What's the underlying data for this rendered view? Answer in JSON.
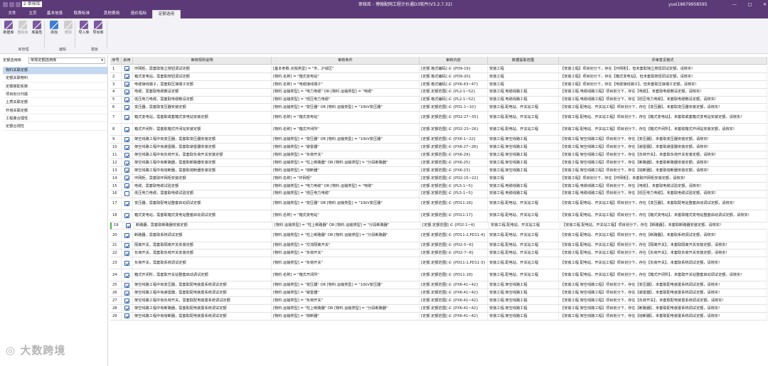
{
  "app": {
    "window_title": "审核库 - 博微配网工程计价通D3软件(V3.2.7.32)",
    "quick_access_value": "2 审核库",
    "user": "yuxi18679958595",
    "min_icon": "minimize-icon",
    "max_icon": "maximize-icon",
    "close_icon": "close-icon"
  },
  "menu": {
    "tabs": [
      "文件",
      "主页",
      "基本信息",
      "取费标准",
      "其他费用",
      "造价指标",
      "定额选用"
    ],
    "active": 6
  },
  "ribbon": {
    "buttons": [
      {
        "label": "新建库",
        "icon": "new-library-icon",
        "disabled": false
      },
      {
        "label": "删除库",
        "icon": "delete-library-icon",
        "disabled": true
      },
      {
        "label": "库属性",
        "icon": "library-properties-icon",
        "disabled": false
      },
      {
        "label": "添加",
        "icon": "add-chart-icon",
        "disabled": false
      },
      {
        "label": "删除",
        "icon": "trash-icon",
        "disabled": true
      },
      {
        "label": "导入库",
        "icon": "import-library-icon",
        "disabled": false
      },
      {
        "label": "导出库",
        "icon": "export-library-icon",
        "disabled": false
      }
    ],
    "groups": [
      "库管理",
      "编辑",
      "模板"
    ],
    "colors": {
      "accent": "#5c3a78",
      "icon_purple": "#7b5aa0",
      "icon_blue": "#3d7fd0",
      "disabled": "#b5b5b5"
    }
  },
  "sidebar": {
    "select_label": "定额选用库",
    "select_value": "常规定额选用库",
    "selected_index": 0,
    "items": [
      "物料关联定额",
      "定额关联物料",
      "定额搭配系数",
      "项目划分归属",
      "土质关联定额",
      "杆塔关联定额",
      "工程量合理性",
      "定额合规性"
    ]
  },
  "table": {
    "headers": [
      "序号",
      "启用",
      "审核规则说明",
      "审核条件",
      "审核内容",
      "数据提取范围",
      "评审意见格式"
    ],
    "rows": [
      {
        "seq": "1",
        "on": true,
        "desc": "环网柜，需套取独立按钮调试定额",
        "cond": "[基本参数.点独类型] = \"市、沪城区\"",
        "content": "[定额.格式编码] ∈ {PD9-19}",
        "range": "安装工程",
        "opinion": "【安装工程】项目划分下，存在【环网柜】，但未套取独立按钮调试定额，请核实!"
      },
      {
        "seq": "2",
        "on": true,
        "desc": "箱式变电站，需套取按钮调试定额",
        "cond": "[物料.名称] = \"箱式变电站\"",
        "content": "[定额.格式编码] ∈ {PD9-20}",
        "range": "安装工程",
        "opinion": "【安装工程】项目划分下，存在【箱式变电站】，但未套取按钮调试定额，请核实!"
      },
      {
        "seq": "3",
        "on": true,
        "desc": "电缆接线端子，需套取压接端子定额",
        "cond": "[物料.名称] = \"电缆接线端子\"",
        "content": "[定额.格式编码] ∈ {PX6-43~47}",
        "range": "安装工程",
        "opinion": "【安装工程】项目划分下，存在【电缆接线端子】，但未套取压接端子定额，请核实!"
      },
      {
        "seq": "4",
        "on": true,
        "desc": "电缆，需套取电缆敷设定额",
        "cond": "[物料.运输类型] = \"电力电缆\" OR [物料.运输类型] = \"电缆\"",
        "content": "[定额.定额范围] ∈ {PL2-1~52}",
        "range": "安装工程.电缆线路工程",
        "opinion": "【安装工程.电缆线路工程】项目划分下，存在【电缆】，未套取电缆敷设定额，请核实!"
      },
      {
        "seq": "5",
        "on": true,
        "desc": "低压电力电缆，需套取电缆敷设定额",
        "cond": "[物料.运输类型] = \"低压电力电缆\"",
        "content": "[定额.格式编码] ∈ {PL2-1~52}",
        "range": "安装工程.电缆线路工程",
        "opinion": "【安装工程.电缆线路工程】项目划分下，存在【低压电力电缆】，未套取电缆敷设定额，请核实!"
      },
      {
        "seq": "6",
        "on": true,
        "desc": "变压器，需套取变压器安装定额",
        "cond": "[物料.运输类型] = \"变压器\" OR [物料.运输类型] = \"10kV变压器\"",
        "content": "[定额.定额范围] ∈ {PD1-1~10}",
        "range": "安装工程.配电站、开关站工程",
        "opinion": "【安装工程.配电站、开关站工程】项目划分下，存在【变压器】，未套取变压器安装定额，请核实!"
      },
      {
        "seq": "7",
        "on": true,
        "desc": "箱式变电站，需套取或套箱式变电站安装定额",
        "cond": "[物料.名称] = \"箱式变电站\"",
        "content": "[定额.定额范围] ∈ {PD2-27~35}",
        "range": "安装工程.配电站、开关站工程",
        "opinion": "【安装工程.配电站、开关站工程】项目划分下，存在【箱式变电站】，未套取或套箱式变电站安装定额，请核实!"
      },
      {
        "seq": "8",
        "on": true,
        "desc": "箱式开闭所，需套取箱式开闭站安装定额",
        "cond": "[物料.名称] = \"箱式开闭所\"",
        "content": "[定额.定额范围] ∈ {PD2-23~26}",
        "range": "安装工程.配电站、开关站工程",
        "opinion": "【安装工程.配电站、开关站工程】项目划分下，存在【箱式开闭所】，未套取箱式开闭站安装定额，请核实!"
      },
      {
        "seq": "9",
        "on": true,
        "desc": "架空线路工程中有变压器，需套取变压器安装定额",
        "cond": "[物料.运输类型] = \"变压器\" OR [物料.运输类型] = \"10kV变压器\"",
        "content": "[定额.定额范围] ∈ {PX6-1~22}",
        "range": "安装工程.架空线路工程",
        "opinion": "【安装工程.架空线路工程】项目划分下，存在【变压器】，未套取变压器安装定额，请核实!"
      },
      {
        "seq": "10",
        "on": true,
        "desc": "架空线路工程中有避雷器，需套取避雷器安装定额",
        "cond": "[物料.运输类型] = \"避雷器\"",
        "content": "[定额.定额范围] ∈ {PX6-27~28}",
        "range": "安装工程.架空线路工程",
        "opinion": "【安装工程.架空线路工程】项目划分下，存在【避雷器】，未套取避雷器安装定额，请核实!"
      },
      {
        "seq": "11",
        "on": true,
        "desc": "架空线路工程中有负荷开关，需套取负荷开关安装定额",
        "cond": "[物料.运输类型] = \"负荷开关\"",
        "content": "[定额.定额范围] ∈ {PX6-29}",
        "range": "安装工程.架空线路工程",
        "opinion": "【安装工程.架空线路工程】项目划分下，存在【负荷开关】，未套取负荷开关安装定额，请核实!"
      },
      {
        "seq": "12",
        "on": true,
        "desc": "架空线路工程中有断路器，需套取断路器安装定额",
        "cond": "[物料.运输类型] = \"柱上断路器\" OR [物料.运输类型] = \"分段断路器\"",
        "content": "[定额.定额范围] ∈ {PX6-25}",
        "range": "安装工程.架空线路工程",
        "opinion": "【安装工程.架空线路工程】项目划分下，存在【断路器】，未套取断路器安装定额，请核实!"
      },
      {
        "seq": "13",
        "on": true,
        "desc": "架空线路工程中有熔断器，需套取熔断器安装定额",
        "cond": "[物料.运输类型] = \"熔断器\"",
        "content": "[定额.定额范围] ∈ {PX6-23}",
        "range": "安装工程.架空线路工程",
        "opinion": "【安装工程.架空线路工程】项目划分下，存在【熔断器】，未套取熔断器安装定额，请核实!"
      },
      {
        "seq": "14",
        "on": true,
        "desc": "环网柜，需套取环网柜安装定额",
        "cond": "[物料.名称] = \"环网柜\"",
        "content": "[定额.定额范围] ∈ {PD2-15~22}",
        "range": "安装工程",
        "opinion": "【安装工程】项目划分下，存在【环网柜】，未套取环网柜安装定额，请核实!"
      },
      {
        "seq": "15",
        "on": true,
        "desc": "电缆，需套取电缆试验定额",
        "cond": "[物料.运输类型] = \"电力电缆\" OR [物料.运输类型] = \"电缆\"",
        "content": "[定额.定额范围] ∈ {PL5-1~5}",
        "range": "安装工程.电缆线路工程",
        "opinion": "【安装工程.电缆线路工程】项目划分下，存在【电缆】，未套取电缆试验定额，请核实!"
      },
      {
        "seq": "16",
        "on": false,
        "desc": "低压电力电缆，需套取电缆试验定额",
        "cond": "[物料.运输类型] = \"低压电力电缆\"",
        "content": "[定额.定额范围] ∈ {PL5-1~5}",
        "range": "安装工程.电缆线路工程",
        "opinion": "【安装工程.电缆线路工程】项目划分下，存在【低压电力电缆】，未套取电缆试验定额，请核实!"
      },
      {
        "seq": "17",
        "on": true,
        "desc": "变压器，需套取配电站整套启动调试定额",
        "cond": "[物料.运输类型] = \"变压器\" OR [物料.运输类型] = \"10kV变压器\"",
        "content": "[定额.定额范围] ∈ {PD11-16}",
        "range": "安装工程.配电站、开关站工程",
        "opinion": "【安装工程.配电站、开关站工程】项目划分下，存在【变压器】，未套取配电站整套启动调试定额，请核实!"
      },
      {
        "seq": "18",
        "on": true,
        "desc": "箱式变电站，需套取箱式变电站整套启动调试定额",
        "cond": "[物料.名称] = \"箱式变电站\"",
        "content": "[定额.定额范围] ∈ {PD11-17}",
        "range": "安装工程.配电站、开关站工程",
        "opinion": "【安装工程.配电站、开关站工程】项目划分下，存在【箱式变电站】，未套取箱式变电站整套启动调试定额，请核实!"
      },
      {
        "seq": "19",
        "on": true,
        "desc": "断路器，需套取断路器安装定额",
        "cond": "[物料.运输类型] = \"柱上断路器\" OR [物料.运输类型] = \"分段断路器\"",
        "content": "[定额.定额范围] ∈ {PD2-1~4}",
        "range": "安装工程.配电站、开关站工程",
        "opinion": "【安装工程.配电站、开关站工程】项目划分下，存在【断路器】，未套取断路器安装定额，请核实!"
      },
      {
        "seq": "20",
        "on": true,
        "desc": "断路器，需套取系统调试定额",
        "cond": "[物料.运输类型] = \"柱上断路器\" OR [物料.运输类型] = \"分段断路器\"",
        "content": "[定额.定额范围] ∈ {PD11-2,PD11-4}",
        "range": "安装工程.配电站、开关站工程",
        "opinion": "【安装工程.配电站、开关站工程】项目划分下，存在【断路器】，未套取系统调试定额，请核实!"
      },
      {
        "seq": "21",
        "on": true,
        "desc": "隔离开关，需套取隔离开关安装定额",
        "cond": "[物料.运输类型] = \"交流隔离开关\"",
        "content": "[定额.定额范围] ∈ {PD2-5~6}",
        "range": "安装工程.配电站、开关站工程",
        "opinion": "【安装工程.配电站、开关站工程】项目划分下，存在【隔离开关】，未套取隔离开关安装定额，请核实!"
      },
      {
        "seq": "22",
        "on": true,
        "desc": "负荷开关，需套取负荷开关安装定额",
        "cond": "[物料.运输类型] = \"负荷开关\"",
        "content": "[定额.定额范围] ∈ {PD2-7~8}",
        "range": "安装工程.配电站、开关站工程",
        "opinion": "【安装工程.配电站、开关站工程】项目划分下，存在【负荷开关】，未套取负荷开关安装定额，请核实!"
      },
      {
        "seq": "23",
        "on": true,
        "desc": "负荷开关，需套取系统调试定额",
        "cond": "[物料.运输类型] = \"负荷开关\"",
        "content": "[定额.定额范围] ∈ {PD11-1,PD11-3}",
        "range": "安装工程.配电站、开关站工程",
        "opinion": "【安装工程.配电站、开关站工程】项目划分下，存在【负荷开关】，未套取系统调试定额，请核实!"
      },
      {
        "seq": "24",
        "on": true,
        "desc": "箱式开闭所，需套取开关站整套启动调试定额",
        "cond": "[物料.名称] = \"箱式开闭所\"",
        "content": "[定额.定额范围] ∈ {PD11-18}",
        "range": "安装工程.配电站、开关站工程",
        "opinion": "【安装工程.配电站、开关站工程】项目划分下，存在【箱式开闭所】，未套取开关站整套启动调试定额，请核实!"
      },
      {
        "seq": "25",
        "on": true,
        "desc": "架空线路工程中有变压器，需套取配电装置系统调试定额",
        "cond": "[物料.运输类型] = \"变压器\" OR [物料.运输类型] = \"10kV变压器\"",
        "content": "[定额.定额范围] ∈ {PX6-41~42}",
        "range": "安装工程.架空线路工程",
        "opinion": "【安装工程.架空线路工程】项目划分下，存在【变压器】，未套取配电装置系统调试定额，请核实!"
      },
      {
        "seq": "26",
        "on": true,
        "desc": "架空线路工程中有避雷器，需套取配电装置系统调试定额",
        "cond": "[物料.运输类型] = \"避雷器\"",
        "content": "[定额.定额范围] ∈ {PX6-41~42}",
        "range": "安装工程.架空线路工程",
        "opinion": "【安装工程.架空线路工程】项目划分下，存在【避雷器】，未套取配电装置系统调试定额，请核实!"
      },
      {
        "seq": "27",
        "on": true,
        "desc": "架空线路工程中有负荷开关，需套取配电装置系统调试定额",
        "cond": "[物料.运输类型] = \"负荷开关\"",
        "content": "[定额.定额范围] ∈ {PX6-41~42}",
        "range": "安装工程.架空线路工程",
        "opinion": "【安装工程.架空线路工程】项目划分下，存在【负荷开关】，未套取配电装置系统调试定额，请核实!"
      },
      {
        "seq": "28",
        "on": true,
        "desc": "架空线路工程中有断路器，需套取配电装置系统调试定额",
        "cond": "[物料.运输类型] = \"柱上断路器\" OR [物料.运输类型] = \"分段断路器\"",
        "content": "[定额.定额范围] ∈ {PX6-41~42}",
        "range": "安装工程.架空线路工程",
        "opinion": "【安装工程.架空线路工程】项目划分下，存在【断路器】，未套取配电装置系统调试定额，请核实!"
      },
      {
        "seq": "29",
        "on": true,
        "desc": "架空线路工程中有熔断器，需套取配电装置系统调试定额",
        "cond": "[物料.运输类型] = \"熔断器\"",
        "content": "[定额.定额范围] ∈ {PX6-41~42}",
        "range": "安装工程.架空线路工程",
        "opinion": "【安装工程.架空线路工程】项目划分下，存在【熔断器】，未套取配电装置系统调试定额，请核实!"
      }
    ]
  },
  "watermark": "大数跨境"
}
